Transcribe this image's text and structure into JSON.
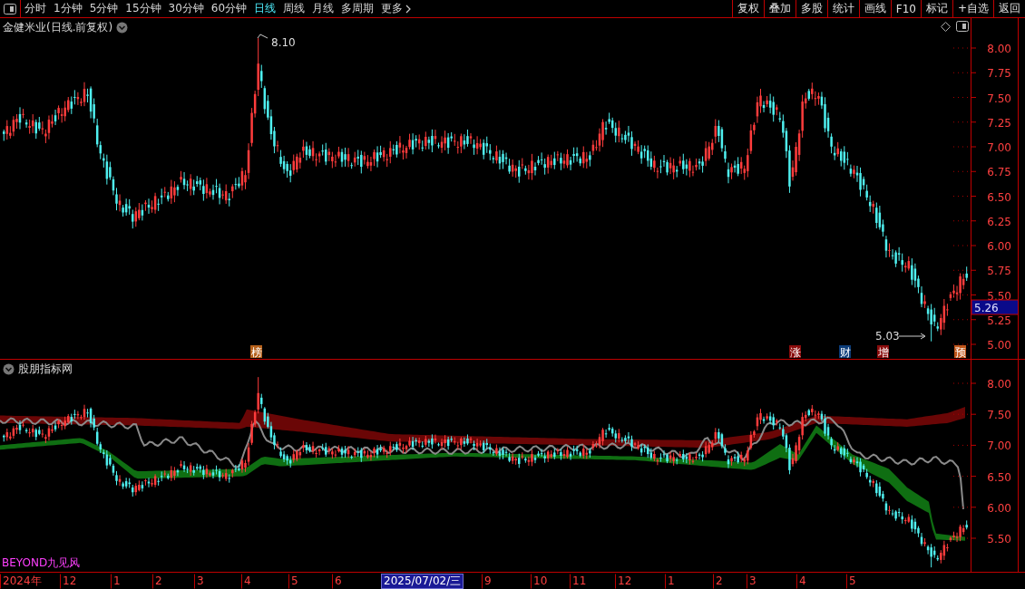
{
  "toolbar": {
    "periods": [
      {
        "label": "分时",
        "selected": false
      },
      {
        "label": "1分钟",
        "selected": false
      },
      {
        "label": "5分钟",
        "selected": false
      },
      {
        "label": "15分钟",
        "selected": false
      },
      {
        "label": "30分钟",
        "selected": false
      },
      {
        "label": "60分钟",
        "selected": false
      },
      {
        "label": "日线",
        "selected": true
      },
      {
        "label": "周线",
        "selected": false
      },
      {
        "label": "月线",
        "selected": false
      },
      {
        "label": "多周期",
        "selected": false
      },
      {
        "label": "更多",
        "selected": false
      }
    ],
    "actions": [
      "复权",
      "叠加",
      "多股",
      "统计",
      "画线",
      "F10",
      "标记",
      "+自选",
      "返回"
    ]
  },
  "main_chart": {
    "title": "金健米业(日线.前复权)",
    "high_label": "8.10",
    "low_label": "5.03",
    "current_price": "5.26",
    "axis_ticks": [
      "8.00",
      "7.75",
      "7.50",
      "7.25",
      "7.00",
      "6.75",
      "6.50",
      "6.25",
      "6.00",
      "5.75",
      "5.50",
      "5.25",
      "5.00"
    ],
    "events": [
      {
        "label": "榜",
        "color": "#b5601a"
      },
      {
        "label": "涨",
        "color": "#8a0c0c"
      },
      {
        "label": "财",
        "color": "#0c3c78"
      },
      {
        "label": "增",
        "color": "#8a0c0c"
      },
      {
        "label": "预",
        "color": "#c0561a"
      }
    ]
  },
  "indicator_panel": {
    "title": "股朋指标网",
    "caption": "BEYOND九见风",
    "axis_ticks": [
      "8.00",
      "7.50",
      "7.00",
      "6.50",
      "6.00",
      "5.50"
    ]
  },
  "time_axis": [
    {
      "label": "2024年",
      "selected": false
    },
    {
      "label": "12",
      "selected": false
    },
    {
      "label": "1",
      "selected": false
    },
    {
      "label": "2",
      "selected": false
    },
    {
      "label": "3",
      "selected": false
    },
    {
      "label": "4",
      "selected": false
    },
    {
      "label": "5",
      "selected": false
    },
    {
      "label": "6",
      "selected": false
    },
    {
      "label": "2025/07/02/三",
      "selected": true
    },
    {
      "label": "9",
      "selected": false
    },
    {
      "label": "10",
      "selected": false
    },
    {
      "label": "11",
      "selected": false
    },
    {
      "label": "12",
      "selected": false
    },
    {
      "label": "1",
      "selected": false
    },
    {
      "label": "2",
      "selected": false
    },
    {
      "label": "3",
      "selected": false
    },
    {
      "label": "4",
      "selected": false
    },
    {
      "label": "5",
      "selected": false
    }
  ]
}
